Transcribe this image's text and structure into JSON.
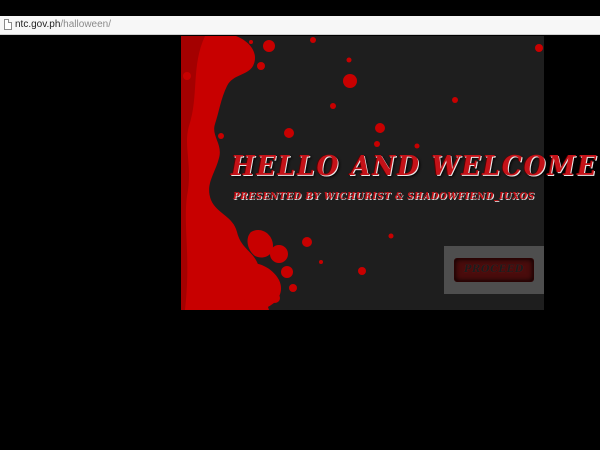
{
  "browser": {
    "url_host": "ntc.gov.ph",
    "url_path": "/halloween/"
  },
  "page": {
    "title": "HELLO AND WELCOME",
    "subtitle": "PRESENTED BY WICHURIST & SHADOWFIEND_IUXOS",
    "proceed_label": "PROCEED"
  },
  "colors": {
    "blood": "#cc0000",
    "stage_bg": "#1e1e1e",
    "page_bg": "#000000"
  }
}
